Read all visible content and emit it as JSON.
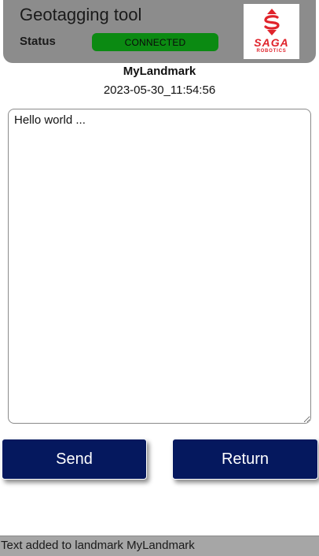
{
  "header": {
    "title": "Geotagging tool",
    "status_label": "Status",
    "status_value": "CONNECTED",
    "status_color": "#0b8a12",
    "logo": {
      "icon": "saga-robotics-logo-icon",
      "brand_text": "SAGA",
      "brand_subtext": "ROBOTICS",
      "brand_color": "#e0232b"
    }
  },
  "landmark": {
    "name": "MyLandmark",
    "timestamp": "2023-05-30_11:54:56"
  },
  "note": {
    "value": "Hello world ..."
  },
  "buttons": {
    "send_label": "Send",
    "return_label": "Return",
    "color": "#05185e"
  },
  "status_bar": {
    "message": "Text added to landmark MyLandmark"
  }
}
